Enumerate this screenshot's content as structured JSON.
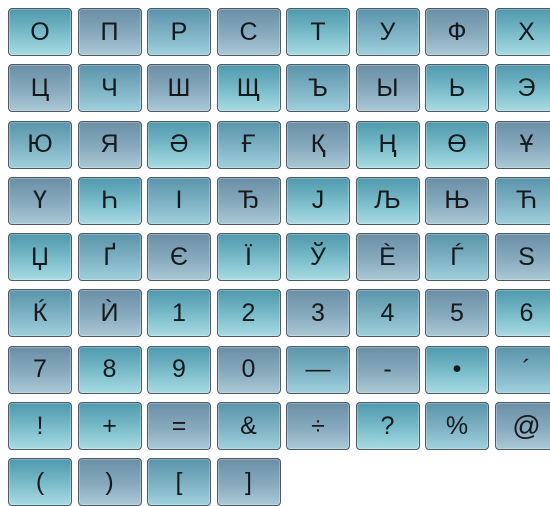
{
  "keyboard": {
    "keys": [
      "О",
      "П",
      "Р",
      "С",
      "Т",
      "У",
      "Ф",
      "Х",
      "Ц",
      "Ч",
      "Ш",
      "Щ",
      "Ъ",
      "Ы",
      "Ь",
      "Э",
      "Ю",
      "Я",
      "Ә",
      "Ғ",
      "Қ",
      "Ң",
      "Ө",
      "Ұ",
      "Ү",
      "Һ",
      "І",
      "Ђ",
      "Ј",
      "Љ",
      "Њ",
      "Ћ",
      "Џ",
      "Ґ",
      "Є",
      "Ї",
      "Ў",
      "È",
      "Ѓ",
      "Ѕ",
      "Ќ",
      "Ѝ",
      "1",
      "2",
      "3",
      "4",
      "5",
      "6",
      "7",
      "8",
      "9",
      "0",
      "—",
      "-",
      "•",
      "´",
      "!",
      "+",
      "=",
      "&",
      "÷",
      "?",
      "%",
      "@",
      "(",
      ")",
      "[",
      "]"
    ],
    "colors": {
      "key_border": "#4f5a63",
      "key_text": "#16191c",
      "gradient_cyan": "#7bbdca",
      "gradient_slate": "#87aabd"
    }
  }
}
